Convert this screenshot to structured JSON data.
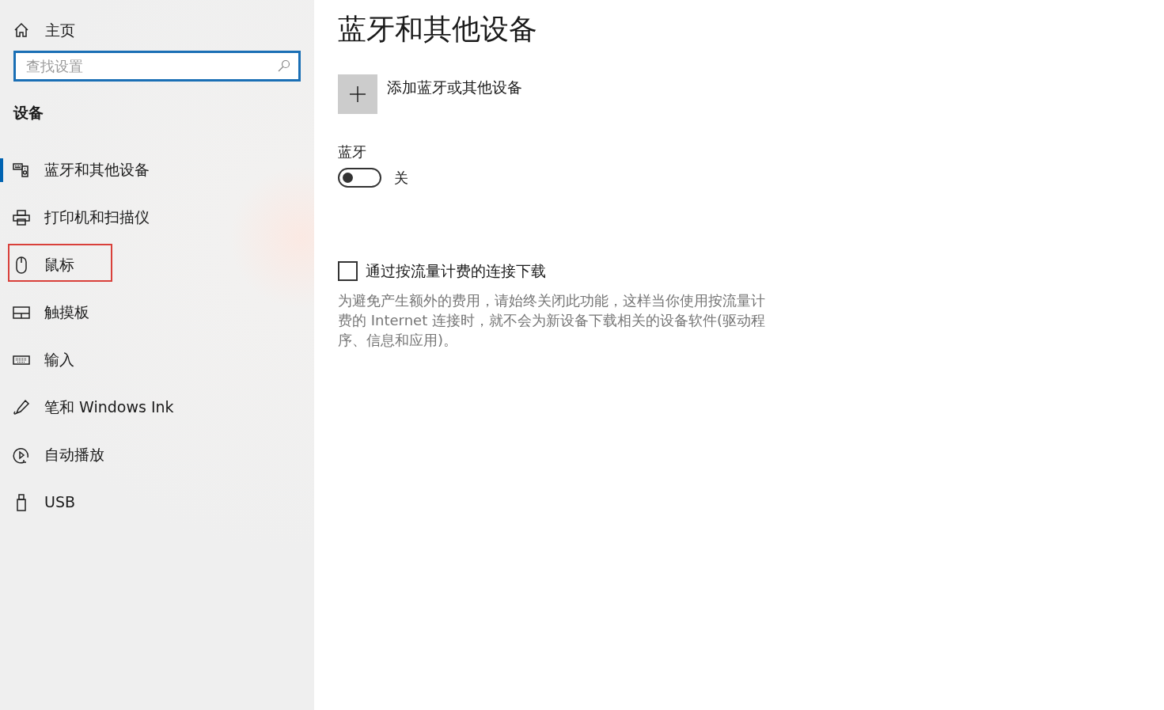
{
  "sidebar": {
    "home": {
      "label": "主页"
    },
    "search": {
      "placeholder": "查找设置"
    },
    "section_title": "设备",
    "items": [
      {
        "label": "蓝牙和其他设备",
        "selected": true,
        "annotated": false
      },
      {
        "label": "打印机和扫描仪",
        "selected": false,
        "annotated": false
      },
      {
        "label": "鼠标",
        "selected": false,
        "annotated": true
      },
      {
        "label": "触摸板",
        "selected": false,
        "annotated": false
      },
      {
        "label": "输入",
        "selected": false,
        "annotated": false
      },
      {
        "label": "笔和 Windows Ink",
        "selected": false,
        "annotated": false
      },
      {
        "label": "自动播放",
        "selected": false,
        "annotated": false
      },
      {
        "label": "USB",
        "selected": false,
        "annotated": false
      }
    ]
  },
  "main": {
    "title": "蓝牙和其他设备",
    "add_button": {
      "label": "添加蓝牙或其他设备"
    },
    "bluetooth": {
      "label": "蓝牙",
      "on": false,
      "state_text": "关"
    },
    "metered": {
      "label": "通过按流量计费的连接下载",
      "checked": false,
      "description": "为避免产生额外的费用，请始终关闭此功能，这样当你使用按流量计费的 Internet 连接时，就不会为新设备下载相关的设备软件(驱动程序、信息和应用)。"
    }
  }
}
